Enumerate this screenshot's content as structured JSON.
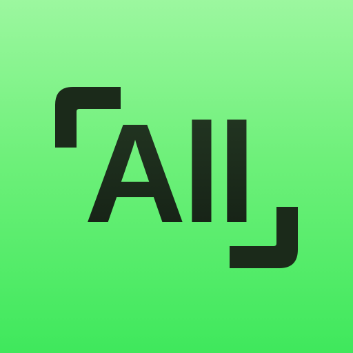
{
  "icon": {
    "wordmark": "All"
  },
  "colors": {
    "background_top": "#9cf79f",
    "background_bottom": "#3fe85c",
    "mark": "#1b2a1a"
  }
}
